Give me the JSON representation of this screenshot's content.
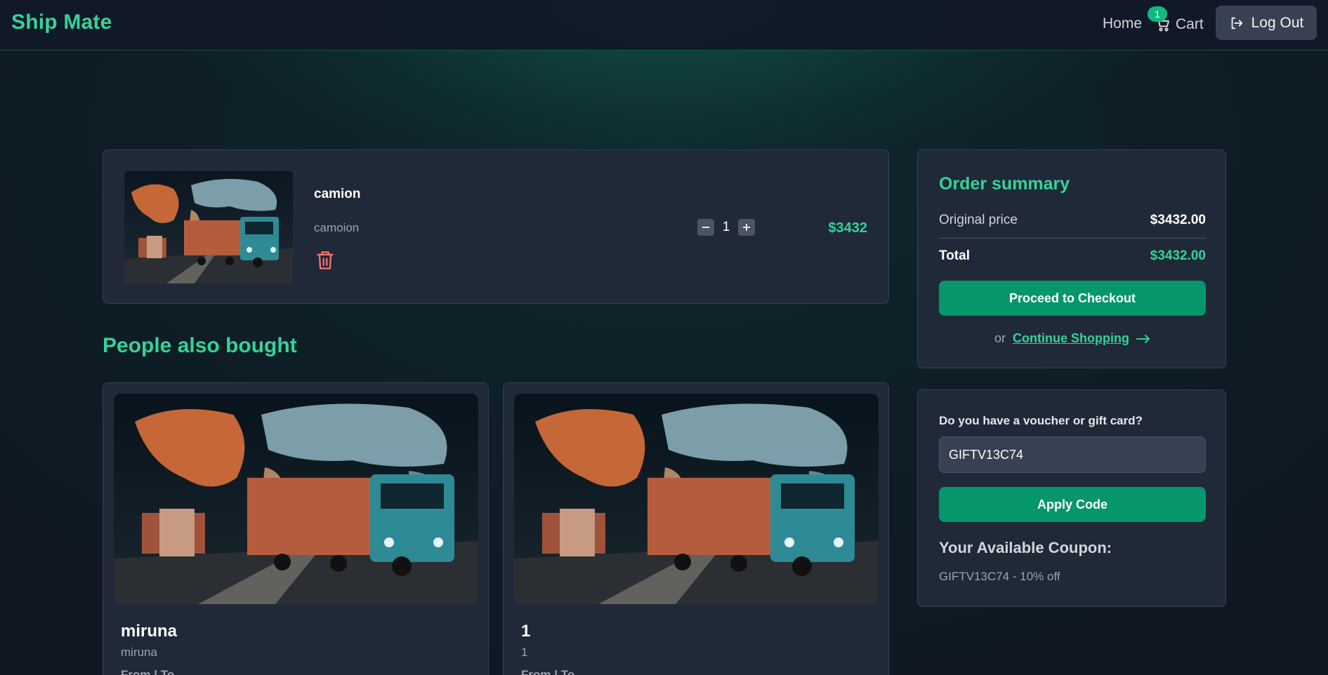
{
  "navbar": {
    "brand": "Ship Mate",
    "home_label": "Home",
    "cart_label": "Cart",
    "cart_count": "1",
    "logout_label": "Log Out"
  },
  "cart_items": [
    {
      "name": "camion",
      "description": "camoion",
      "quantity": "1",
      "price": "$3432",
      "image_icon": "truck-world-map-image"
    }
  ],
  "order_summary": {
    "title": "Order summary",
    "original_price_label": "Original price",
    "original_price_value": "$3432.00",
    "total_label": "Total",
    "total_value": "$3432.00",
    "checkout_label": "Proceed to Checkout",
    "or_text": "or",
    "continue_label": "Continue Shopping"
  },
  "voucher": {
    "label": "Do you have a voucher or gift card?",
    "input_value": "GIFTV13C74",
    "apply_label": "Apply Code",
    "available_title": "Your Available Coupon:",
    "available_text": "GIFTV13C74 - 10% off"
  },
  "people_also_bought": {
    "title": "People also bought",
    "products": [
      {
        "name": "miruna",
        "subtitle": "miruna",
        "route": "From | To"
      },
      {
        "name": "1",
        "subtitle": "1",
        "route": "From | To"
      }
    ]
  },
  "colors": {
    "accent": "#34d399",
    "button": "#059669",
    "card": "#1f2937",
    "danger": "#f87171"
  }
}
